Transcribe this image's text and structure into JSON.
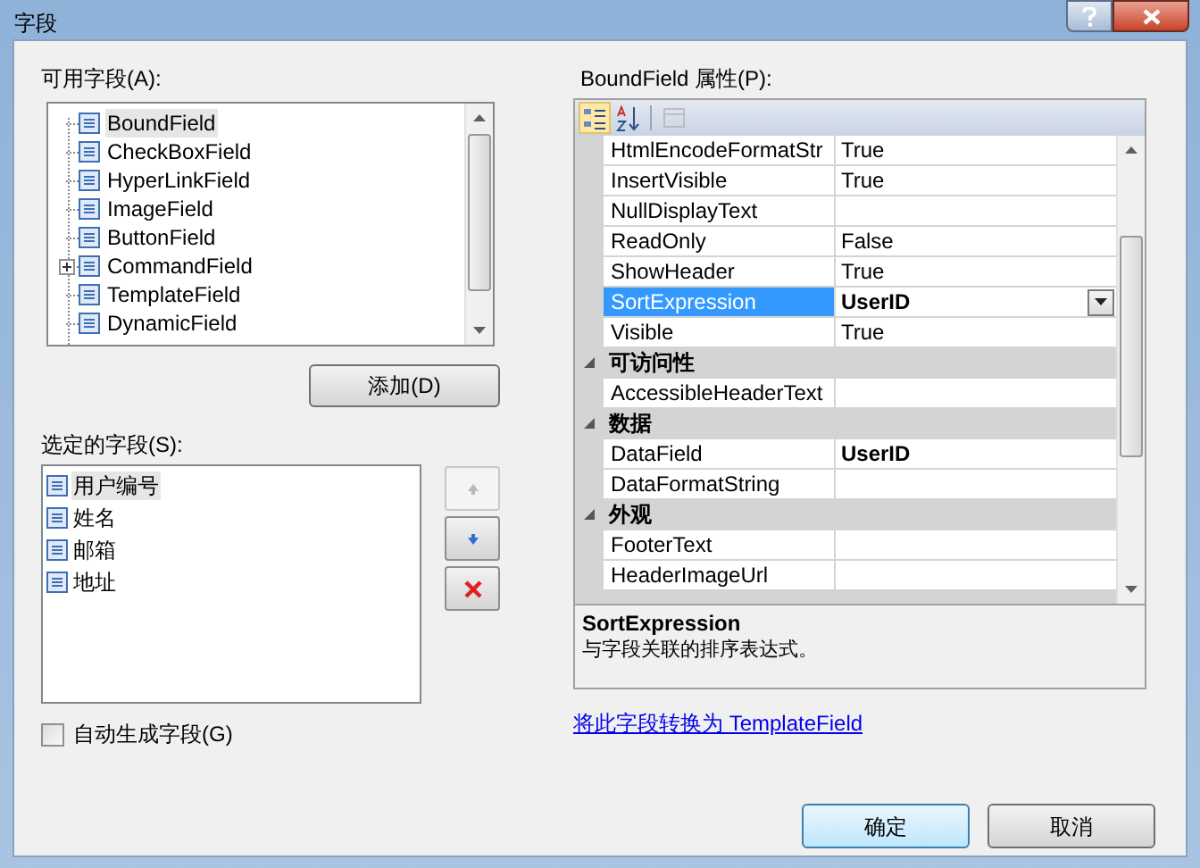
{
  "window": {
    "title": "字段"
  },
  "available_fields": {
    "label": "可用字段(A):",
    "items": [
      {
        "label": "BoundField",
        "kind": "leaf",
        "selected": true
      },
      {
        "label": "CheckBoxField",
        "kind": "leaf",
        "selected": false
      },
      {
        "label": "HyperLinkField",
        "kind": "leaf",
        "selected": false
      },
      {
        "label": "ImageField",
        "kind": "leaf",
        "selected": false
      },
      {
        "label": "ButtonField",
        "kind": "leaf",
        "selected": false
      },
      {
        "label": "CommandField",
        "kind": "group",
        "selected": false
      },
      {
        "label": "TemplateField",
        "kind": "leaf",
        "selected": false
      },
      {
        "label": "DynamicField",
        "kind": "leaf",
        "selected": false
      }
    ]
  },
  "add_button": {
    "label": "添加(D)"
  },
  "selected_fields": {
    "label": "选定的字段(S):",
    "items": [
      {
        "label": "用户编号",
        "selected": true
      },
      {
        "label": "姓名",
        "selected": false
      },
      {
        "label": "邮箱",
        "selected": false
      },
      {
        "label": "地址",
        "selected": false
      }
    ]
  },
  "move_buttons": [
    {
      "kind": "up",
      "disabled": true
    },
    {
      "kind": "down",
      "disabled": false
    },
    {
      "kind": "delete",
      "disabled": false
    }
  ],
  "auto_generate": {
    "label": "自动生成字段(G)",
    "checked": false
  },
  "properties": {
    "label": "BoundField 属性(P):",
    "toolbar": [
      {
        "kind": "categorized",
        "selected": true,
        "disabled": false
      },
      {
        "kind": "alphabetical",
        "selected": false,
        "disabled": false
      },
      {
        "kind": "pages",
        "selected": false,
        "disabled": true
      }
    ],
    "rows": [
      {
        "kind": "property",
        "name": "HtmlEncodeFormatStr",
        "value": "True",
        "bold": false,
        "selected": false
      },
      {
        "kind": "property",
        "name": "InsertVisible",
        "value": "True",
        "bold": false,
        "selected": false
      },
      {
        "kind": "property",
        "name": "NullDisplayText",
        "selected": false
      },
      {
        "kind": "property",
        "name": "ReadOnly",
        "value": "False",
        "bold": false,
        "selected": false
      },
      {
        "kind": "property",
        "name": "ShowHeader",
        "value": "True",
        "bold": false,
        "selected": false
      },
      {
        "kind": "property",
        "name": "SortExpression",
        "value": "UserID",
        "bold": true,
        "selected": true
      },
      {
        "kind": "property",
        "name": "Visible",
        "value": "True",
        "bold": false,
        "selected": false
      },
      {
        "kind": "category",
        "name": "可访问性",
        "expanded": true
      },
      {
        "kind": "property",
        "name": "AccessibleHeaderText",
        "selected": false
      },
      {
        "kind": "category",
        "name": "数据",
        "expanded": true
      },
      {
        "kind": "property",
        "name": "DataField",
        "value": "UserID",
        "bold": true,
        "selected": false
      },
      {
        "kind": "property",
        "name": "DataFormatString",
        "selected": false
      },
      {
        "kind": "category",
        "name": "外观",
        "expanded": true
      },
      {
        "kind": "property",
        "name": "FooterText",
        "selected": false
      },
      {
        "kind": "property",
        "name": "HeaderImageUrl",
        "selected": false
      }
    ],
    "description": {
      "title": "SortExpression",
      "text": "与字段关联的排序表达式。"
    }
  },
  "convert_link": "将此字段转换为 TemplateField",
  "buttons": [
    {
      "label": "确定",
      "default": true
    },
    {
      "label": "取消",
      "default": false
    }
  ]
}
